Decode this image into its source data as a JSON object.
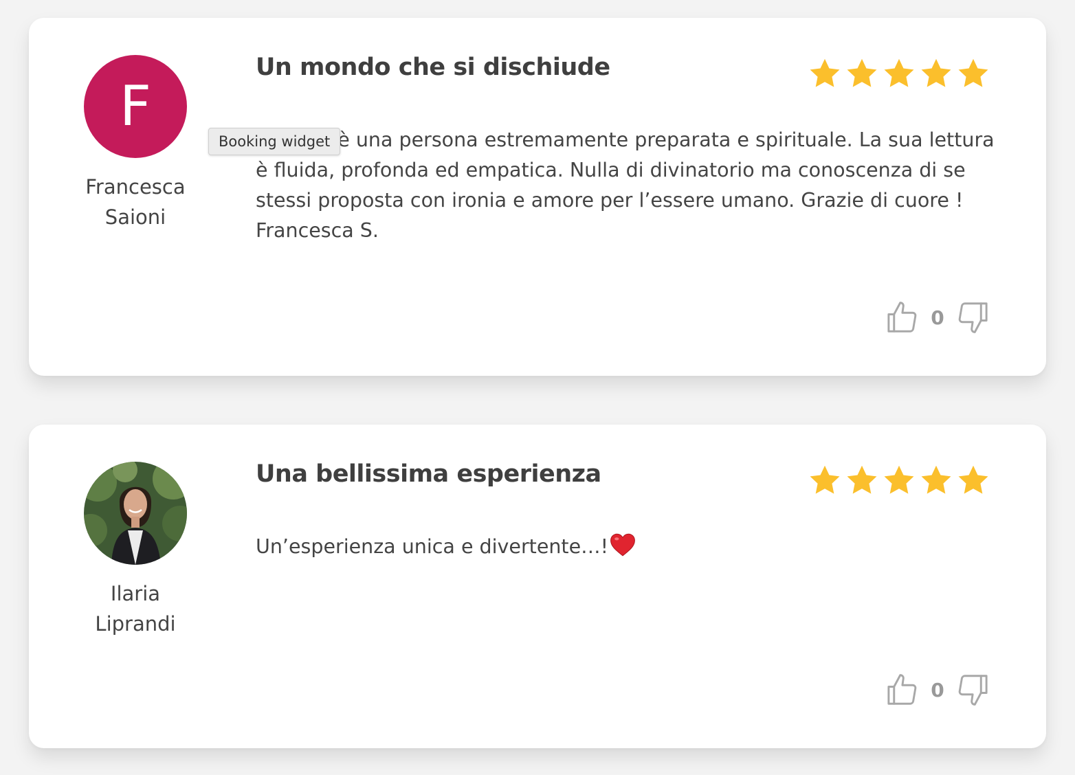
{
  "tooltip": "Booking widget",
  "colors": {
    "star": "#fbbf2c",
    "avatar_bg": "#c41b5a",
    "vote_icon": "#a8a8a8"
  },
  "reviews": [
    {
      "author_initial": "F",
      "author_first": "Francesca",
      "author_last": "Saioni",
      "title": "Un mondo che si dischiude",
      "rating": 5,
      "text": "Arianna è una persona estremamente preparata e spirituale. La sua lettura è fluida, profonda ed empatica. Nulla di divinatorio ma conoscenza di se stessi proposta con ironia e amore per l’essere umano. Grazie di cuore ! Francesca S.",
      "likes": "0"
    },
    {
      "author_initial": "",
      "author_first": "Ilaria",
      "author_last": "Liprandi",
      "title": "Una bellissima esperienza",
      "rating": 5,
      "text": "Un’esperienza unica e divertente…!",
      "likes": "0"
    }
  ]
}
